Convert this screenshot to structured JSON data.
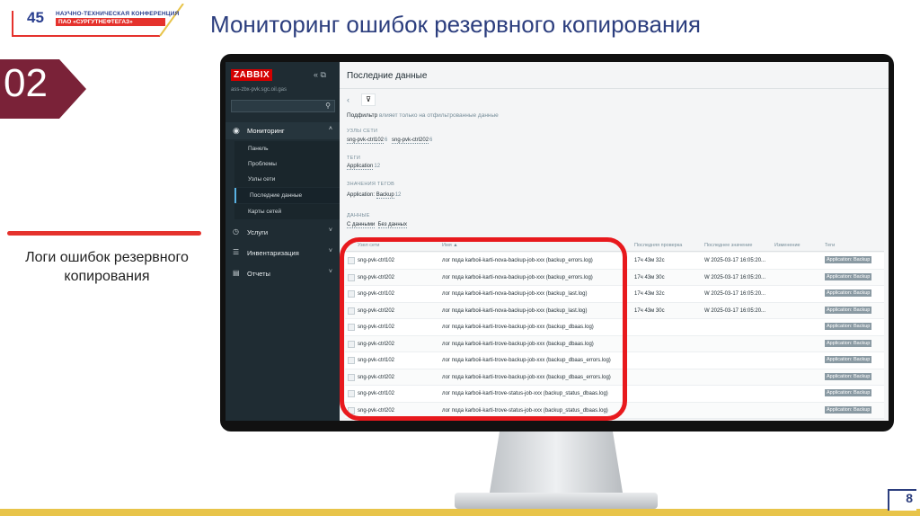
{
  "header": {
    "logo_number": "45",
    "logo_line1": "НАУЧНО-ТЕХНИЧЕСКАЯ КОНФЕРЕНЦИЯ",
    "logo_line2": "ПАО «СУРГУТНЕФТЕГАЗ»",
    "title": "Мониторинг ошибок резервного копирования"
  },
  "section_badge": "02",
  "caption": "Логи ошибок резервного копирования",
  "page_number": "8",
  "zabbix": {
    "sidebar": {
      "logo": "ZABBIX",
      "host": "ass-zbx-pvk.sgc.oil.gas",
      "menu": [
        {
          "label": "Мониторинг",
          "icon": "eye-icon",
          "expanded": true,
          "children": [
            "Панель",
            "Проблемы",
            "Узлы сети",
            "Последние данные",
            "Карты сетей"
          ],
          "active_child": "Последние данные"
        },
        {
          "label": "Услуги",
          "icon": "clock-icon"
        },
        {
          "label": "Инвентаризация",
          "icon": "list-icon"
        },
        {
          "label": "Отчеты",
          "icon": "report-icon"
        }
      ]
    },
    "page_title": "Последние данные",
    "subfilter_label": "Подфильтр",
    "subfilter_note": "влияет только на отфильтрованные данные",
    "filters": {
      "hosts_label": "УЗЛЫ СЕТИ",
      "hosts": [
        {
          "name": "sng-pvk-ctrl102",
          "count": "6"
        },
        {
          "name": "sng-pvk-ctrl202",
          "count": "6"
        }
      ],
      "tags_label": "ТЕГИ",
      "tags": [
        {
          "name": "Application",
          "count": "12"
        }
      ],
      "tag_values_label": "ЗНАЧЕНИЯ ТЕГОВ",
      "tag_values_key": "Application:",
      "tag_values": [
        {
          "name": "Backup",
          "count": "12"
        }
      ],
      "data_label": "ДАННЫЕ",
      "data_options": [
        "С данными",
        "Без данных"
      ]
    },
    "table": {
      "columns": [
        "Узел сети",
        "Имя ▲",
        "Последняя проверка",
        "Последнее значение",
        "Изменение",
        "Теги"
      ],
      "rows": [
        {
          "host": "sng-pvk-ctrl102",
          "name": "лог пода karboii-karti-nova-backup-job-xxx (backup_errors.log)",
          "last_check": "17ч 43м 32с",
          "last_value": "W 2025-03-17 16:05:20...",
          "tag": "Application: Backup"
        },
        {
          "host": "sng-pvk-ctrl202",
          "name": "лог пода karboii-karti-nova-backup-job-xxx (backup_errors.log)",
          "last_check": "17ч 43м 30с",
          "last_value": "W 2025-03-17 16:05:20...",
          "tag": "Application: Backup"
        },
        {
          "host": "sng-pvk-ctrl102",
          "name": "лог пода karboii-karti-nova-backup-job-xxx (backup_last.log)",
          "last_check": "17ч 43м 32с",
          "last_value": "W 2025-03-17 16:05:20...",
          "tag": "Application: Backup"
        },
        {
          "host": "sng-pvk-ctrl202",
          "name": "лог пода karboii-karti-nova-backup-job-xxx (backup_last.log)",
          "last_check": "17ч 43м 30с",
          "last_value": "W 2025-03-17 16:05:20...",
          "tag": "Application: Backup"
        },
        {
          "host": "sng-pvk-ctrl102",
          "name": "лог пода karboii-karti-trove-backup-job-xxx (backup_dbaas.log)",
          "last_check": "",
          "last_value": "",
          "tag": "Application: Backup"
        },
        {
          "host": "sng-pvk-ctrl202",
          "name": "лог пода karboii-karti-trove-backup-job-xxx (backup_dbaas.log)",
          "last_check": "",
          "last_value": "",
          "tag": "Application: Backup"
        },
        {
          "host": "sng-pvk-ctrl102",
          "name": "лог пода karboii-karti-trove-backup-job-xxx (backup_dbaas_errors.log)",
          "last_check": "",
          "last_value": "",
          "tag": "Application: Backup"
        },
        {
          "host": "sng-pvk-ctrl202",
          "name": "лог пода karboii-karti-trove-backup-job-xxx (backup_dbaas_errors.log)",
          "last_check": "",
          "last_value": "",
          "tag": "Application: Backup"
        },
        {
          "host": "sng-pvk-ctrl102",
          "name": "лог пода karboii-karti-trove-status-job-xxx (backup_status_dbaas.log)",
          "last_check": "",
          "last_value": "",
          "tag": "Application: Backup"
        },
        {
          "host": "sng-pvk-ctrl202",
          "name": "лог пода karboii-karti-trove-status-job-xxx (backup_status_dbaas.log)",
          "last_check": "",
          "last_value": "",
          "tag": "Application: Backup"
        }
      ]
    }
  },
  "colors": {
    "brand_blue": "#2c3e7e",
    "accent_red": "#e5322d",
    "badge_maroon": "#7a2238",
    "zabbix_sidebar": "#1f2c33",
    "highlight": "#e8191d"
  }
}
